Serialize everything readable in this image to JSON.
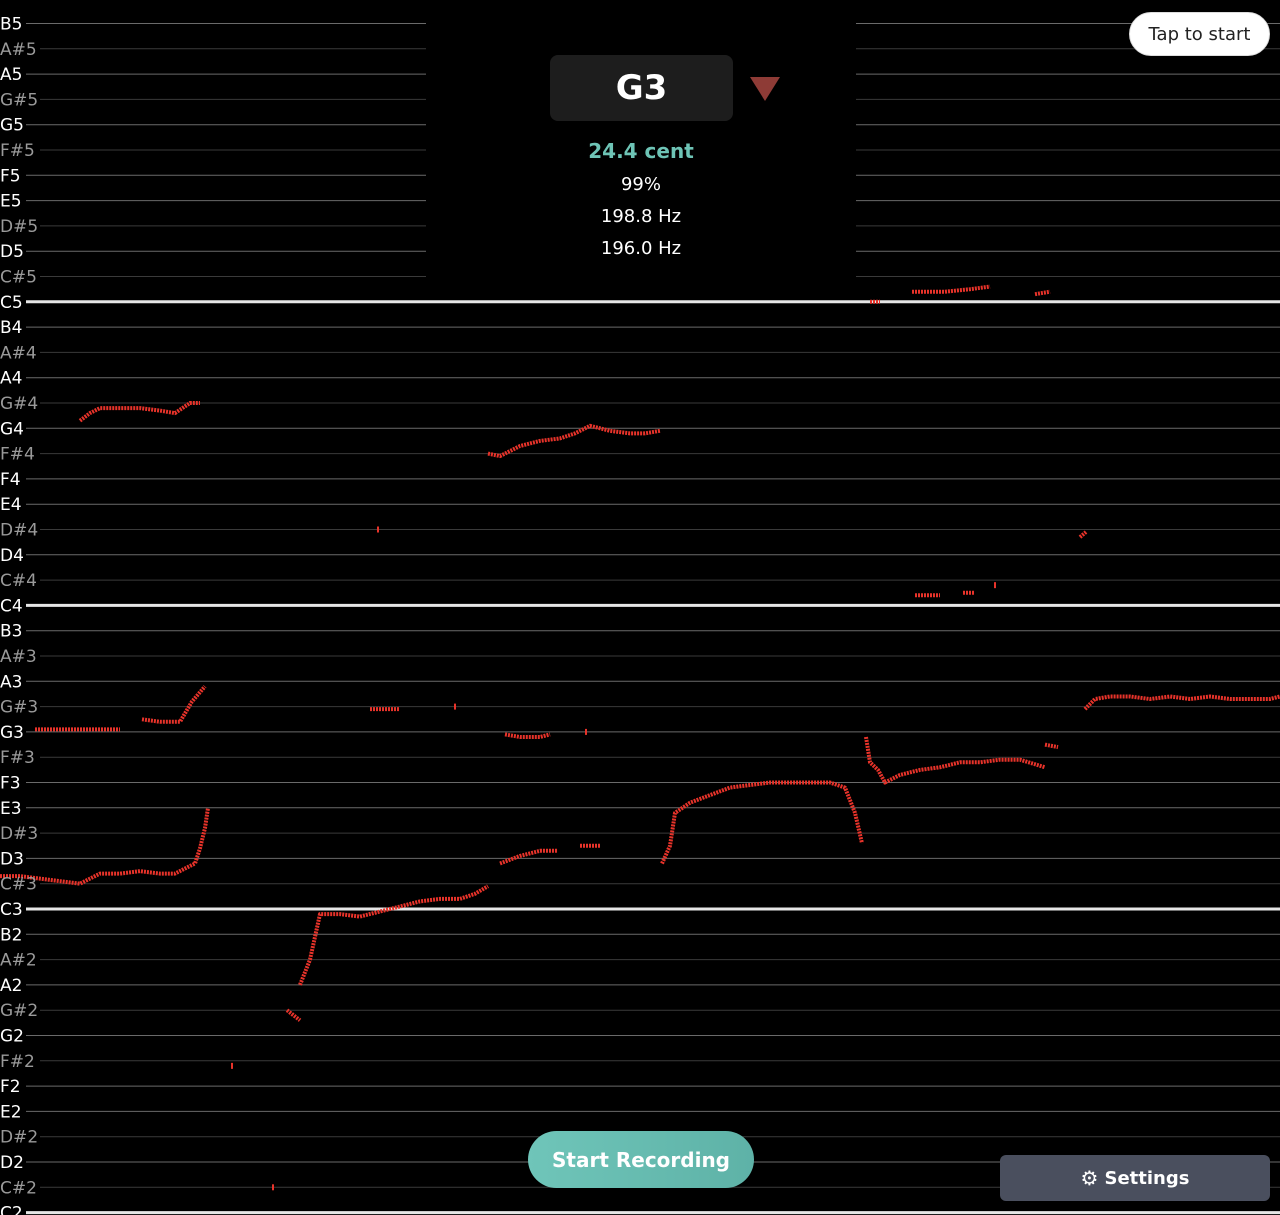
{
  "notes": [
    "B5",
    "A#5",
    "A5",
    "G#5",
    "G5",
    "F#5",
    "F5",
    "E5",
    "D#5",
    "D5",
    "C#5",
    "C5",
    "B4",
    "A#4",
    "A4",
    "G#4",
    "G4",
    "F#4",
    "F4",
    "E4",
    "D#4",
    "D4",
    "C#4",
    "C4",
    "B3",
    "A#3",
    "A3",
    "G#3",
    "G3",
    "F#3",
    "F3",
    "E3",
    "D#3",
    "D3",
    "C#3",
    "C3",
    "B2",
    "A#2",
    "A2",
    "G#2",
    "G2",
    "F#2",
    "F2",
    "E2",
    "D#2",
    "D2",
    "C#2",
    "C2"
  ],
  "tuner": {
    "note": "G3",
    "direction_icon": "down-triangle-icon",
    "cent": "24.4 cent",
    "confidence": "99%",
    "detected_hz": "198.8 Hz",
    "target_hz": "196.0 Hz"
  },
  "tap_label": "Tap to start",
  "record_label": "Start Recording",
  "settings": {
    "icon": "gear-icon",
    "label": "Settings"
  },
  "colors": {
    "background": "#000000",
    "line": "#6a6a6a",
    "c_line": "#e6e6e6",
    "natural_text": "#ffffff",
    "sharp_text": "#9a9a9a",
    "pitch_trace": "#e8332a",
    "accent": "#6ec4b6",
    "flat_arrow": "#8e3b36",
    "settings_bg": "#4a4f5e"
  },
  "pitch_trace": {
    "unit": "semitones relative to C2",
    "segments": [
      [
        [
          0,
          13.3
        ],
        [
          20,
          13.3
        ],
        [
          40,
          13.2
        ],
        [
          60,
          13.1
        ],
        [
          80,
          13.0
        ],
        [
          90,
          13.2
        ],
        [
          100,
          13.4
        ],
        [
          120,
          13.4
        ],
        [
          140,
          13.5
        ],
        [
          160,
          13.4
        ],
        [
          175,
          13.4
        ],
        [
          185,
          13.6
        ],
        [
          195,
          13.8
        ],
        [
          200,
          14.4
        ],
        [
          205,
          15.2
        ],
        [
          208,
          16.0
        ]
      ],
      [
        [
          35,
          19.1
        ],
        [
          60,
          19.1
        ],
        [
          80,
          19.1
        ],
        [
          100,
          19.1
        ],
        [
          120,
          19.1
        ]
      ],
      [
        [
          142,
          19.5
        ],
        [
          160,
          19.4
        ],
        [
          180,
          19.4
        ],
        [
          192,
          20.2
        ],
        [
          205,
          20.8
        ]
      ],
      [
        [
          300,
          9.0
        ],
        [
          310,
          10.0
        ],
        [
          320,
          11.8
        ],
        [
          340,
          11.8
        ],
        [
          360,
          11.7
        ],
        [
          380,
          11.9
        ],
        [
          400,
          12.1
        ],
        [
          420,
          12.3
        ],
        [
          440,
          12.4
        ],
        [
          460,
          12.4
        ],
        [
          475,
          12.6
        ],
        [
          488,
          12.9
        ]
      ],
      [
        [
          500,
          13.8
        ],
        [
          520,
          14.1
        ],
        [
          540,
          14.3
        ],
        [
          558,
          14.3
        ]
      ],
      [
        [
          580,
          14.5
        ],
        [
          600,
          14.5
        ]
      ],
      [
        [
          662,
          13.8
        ],
        [
          670,
          14.5
        ],
        [
          675,
          15.8
        ],
        [
          690,
          16.2
        ],
        [
          710,
          16.5
        ],
        [
          730,
          16.8
        ],
        [
          750,
          16.9
        ],
        [
          770,
          17.0
        ],
        [
          790,
          17.0
        ],
        [
          810,
          17.0
        ],
        [
          830,
          17.0
        ],
        [
          845,
          16.8
        ],
        [
          855,
          15.8
        ],
        [
          862,
          14.6
        ]
      ],
      [
        [
          866,
          18.8
        ],
        [
          870,
          17.8
        ],
        [
          878,
          17.5
        ],
        [
          885,
          17.0
        ],
        [
          900,
          17.3
        ],
        [
          920,
          17.5
        ],
        [
          940,
          17.6
        ],
        [
          960,
          17.8
        ],
        [
          980,
          17.8
        ],
        [
          1000,
          17.9
        ],
        [
          1020,
          17.9
        ],
        [
          1045,
          17.6
        ]
      ],
      [
        [
          1045,
          18.5
        ],
        [
          1058,
          18.4
        ]
      ],
      [
        [
          1085,
          19.9
        ],
        [
          1095,
          20.3
        ],
        [
          1110,
          20.4
        ],
        [
          1130,
          20.4
        ],
        [
          1150,
          20.3
        ],
        [
          1170,
          20.4
        ],
        [
          1190,
          20.3
        ],
        [
          1210,
          20.4
        ],
        [
          1230,
          20.3
        ],
        [
          1250,
          20.3
        ],
        [
          1270,
          20.3
        ],
        [
          1280,
          20.4
        ]
      ],
      [
        [
          80,
          31.3
        ],
        [
          90,
          31.6
        ],
        [
          100,
          31.8
        ],
        [
          120,
          31.8
        ],
        [
          140,
          31.8
        ],
        [
          160,
          31.7
        ],
        [
          175,
          31.6
        ],
        [
          190,
          32.0
        ],
        [
          200,
          32.0
        ]
      ],
      [
        [
          488,
          30.0
        ],
        [
          500,
          29.9
        ],
        [
          520,
          30.3
        ],
        [
          540,
          30.5
        ],
        [
          560,
          30.6
        ],
        [
          575,
          30.8
        ],
        [
          590,
          31.1
        ],
        [
          610,
          30.9
        ],
        [
          630,
          30.8
        ],
        [
          645,
          30.8
        ],
        [
          660,
          30.9
        ]
      ],
      [
        [
          870,
          36.0
        ],
        [
          880,
          36.0
        ]
      ],
      [
        [
          912,
          36.4
        ],
        [
          930,
          36.4
        ],
        [
          945,
          36.4
        ],
        [
          970,
          36.5
        ],
        [
          990,
          36.6
        ]
      ],
      [
        [
          1035,
          36.3
        ],
        [
          1050,
          36.4
        ]
      ],
      [
        [
          1080,
          26.7
        ],
        [
          1086,
          26.9
        ]
      ],
      [
        [
          915,
          24.4
        ],
        [
          940,
          24.4
        ]
      ],
      [
        [
          963,
          24.5
        ],
        [
          975,
          24.5
        ]
      ],
      [
        [
          505,
          18.9
        ],
        [
          520,
          18.8
        ],
        [
          540,
          18.8
        ],
        [
          550,
          18.9
        ]
      ],
      [
        [
          370,
          19.9
        ],
        [
          400,
          19.9
        ]
      ],
      [
        [
          287,
          8.0
        ],
        [
          300,
          7.6
        ]
      ]
    ],
    "dots": [
      [
        378,
        27.0
      ],
      [
        455,
        20.0
      ],
      [
        586,
        19.0
      ],
      [
        995,
        24.8
      ],
      [
        232,
        5.8
      ],
      [
        273,
        1.0
      ]
    ]
  }
}
